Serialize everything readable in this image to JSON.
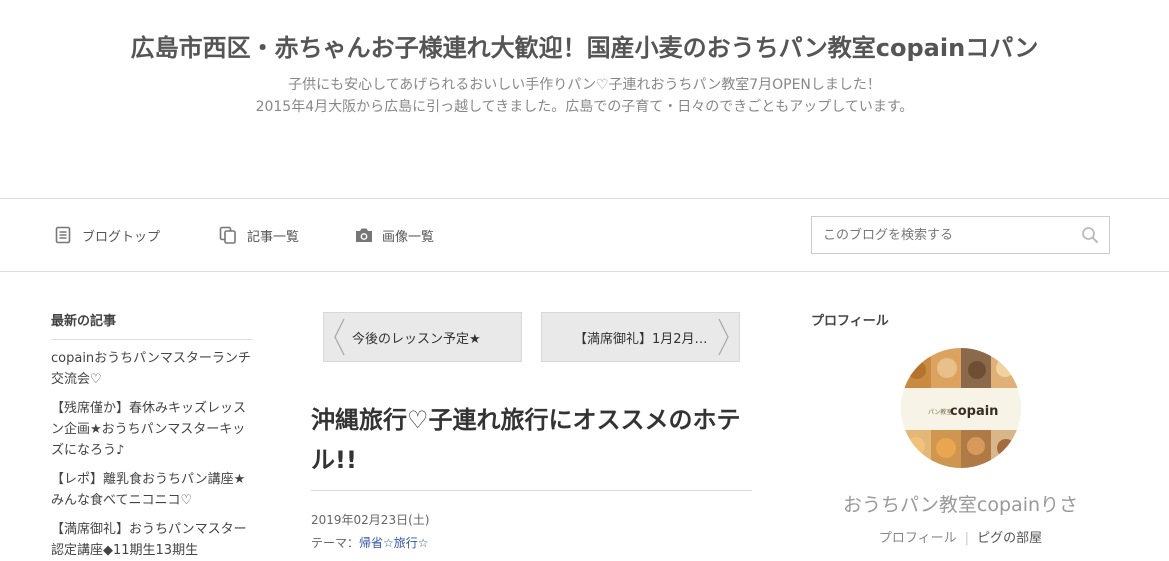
{
  "header": {
    "title": "広島市西区・赤ちゃんお子様連れ大歓迎！国産小麦のおうちパン教室copainコパン",
    "desc_line1": "子供にも安心してあげられるおいしい手作りパン♡子連れおうちパン教室7月OPENしました！",
    "desc_line2": "2015年4月大阪から広島に引っ越してきました。広島での子育て・日々のできごともアップしています。"
  },
  "nav": {
    "items": [
      {
        "label": "ブログトップ",
        "icon": "document-icon"
      },
      {
        "label": "記事一覧",
        "icon": "copy-icon"
      },
      {
        "label": "画像一覧",
        "icon": "camera-icon"
      }
    ],
    "search_placeholder": "このブログを検索する",
    "search_icon": "search-icon"
  },
  "sidebar": {
    "heading": "最新の記事",
    "items": [
      "copainおうちパンマスターランチ交流会♡",
      "【残席僅か】春休みキッズレッスン企画★おうちパンマスターキッズになろう♪",
      "【レポ】離乳食おうちパン講座★みんな食べてニコニコ♡",
      "【満席御礼】おうちパンマスター認定講座◆11期生13期生"
    ]
  },
  "pager": {
    "prev_label": "今後のレッスン予定★",
    "next_label": "【満席御礼】1月2月…"
  },
  "entry": {
    "title": "沖縄旅行♡子連れ旅行にオススメのホテル!!",
    "date": "2019年02月23日(土)",
    "theme_label": "テーマ：",
    "theme": "帰省☆旅行☆"
  },
  "profile": {
    "heading": "プロフィール",
    "logo_small": "パン教室",
    "logo_text": "copain",
    "name": "おうちパン教室copainりさ",
    "link_profile": "プロフィール",
    "link_room": "ピグの部屋"
  },
  "colors": {
    "link_blue": "#3355a8",
    "rule_gray": "#dddddd",
    "pager_bg": "#e9e9e9"
  }
}
